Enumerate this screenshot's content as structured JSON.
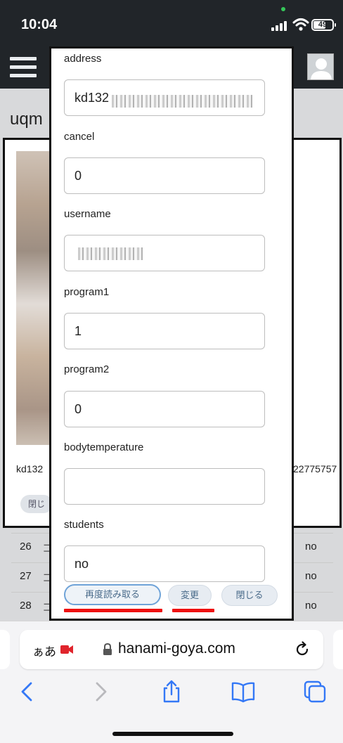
{
  "status_bar": {
    "time": "10:04",
    "battery": "49"
  },
  "background": {
    "page_title": "uqm",
    "card_id_left": "kd132",
    "card_id_right": "22775757",
    "card_close": "閉じ",
    "rows": [
      {
        "num": "26",
        "cell": "コ",
        "value": "no"
      },
      {
        "num": "27",
        "cell": "コ",
        "value": "no"
      },
      {
        "num": "28",
        "cell": "コ",
        "value": "no"
      }
    ]
  },
  "modal": {
    "fields": [
      {
        "label": "address",
        "value": "kd132"
      },
      {
        "label": "cancel",
        "value": "0"
      },
      {
        "label": "username",
        "value": ""
      },
      {
        "label": "program1",
        "value": "1"
      },
      {
        "label": "program2",
        "value": "0"
      },
      {
        "label": "bodytemperature",
        "value": ""
      },
      {
        "label": "students",
        "value": "no"
      }
    ],
    "buttons": {
      "reread": "再度読み取る",
      "change": "変更",
      "close": "閉じる"
    }
  },
  "safari": {
    "aa_label": "ぁあ",
    "url": "hanami-goya.com"
  },
  "colors": {
    "dark_header": "#212529",
    "underline_red": "#e11",
    "link_blue": "#3478f6"
  }
}
